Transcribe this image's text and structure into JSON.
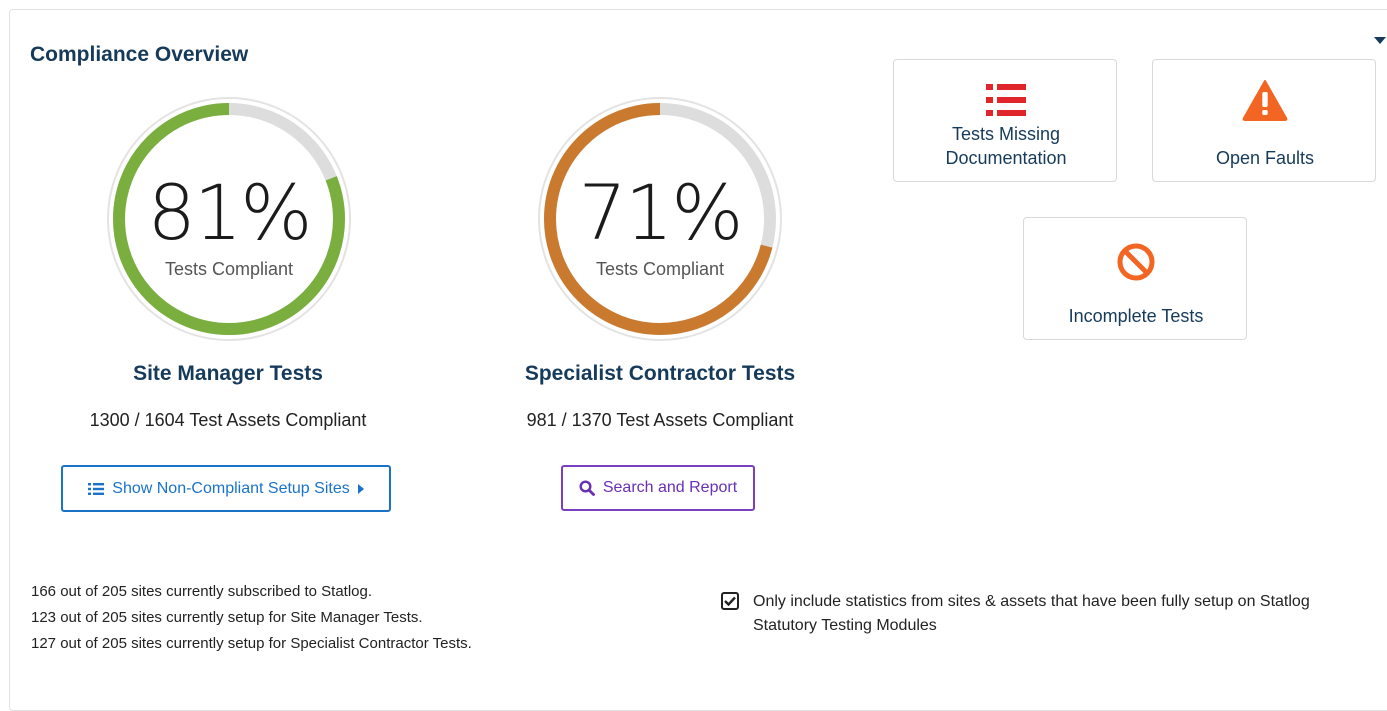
{
  "header": {
    "title": "Compliance Overview"
  },
  "colors": {
    "green": "#7aaf3f",
    "orange": "#c97a2f",
    "track": "#dddddd"
  },
  "site_manager": {
    "percent_value": 0.81,
    "percent_label": "81%",
    "gauge_caption": "Tests Compliant",
    "title": "Site Manager Tests",
    "count_text": "1300 / 1604 Test Assets Compliant",
    "button_label": "Show Non-Compliant Setup Sites"
  },
  "specialist": {
    "percent_value": 0.71,
    "percent_label": "71%",
    "gauge_caption": "Tests Compliant",
    "title": "Specialist Contractor Tests",
    "count_text": "981 / 1370 Test Assets Compliant",
    "button_label": "Search and Report"
  },
  "tiles": {
    "missing_docs_line1": "Tests Missing",
    "missing_docs_line2": "Documentation",
    "open_faults": "Open Faults",
    "incomplete_tests": "Incomplete Tests"
  },
  "stats": [
    "166 out of 205 sites currently subscribed to Statlog.",
    "123 out of 205 sites currently setup for Site Manager Tests.",
    "127 out of 205 sites currently setup for Specialist Contractor Tests."
  ],
  "filter": {
    "checked": true,
    "label": "Only include statistics from sites & assets that have been fully setup on Statlog Statutory Testing Modules"
  }
}
